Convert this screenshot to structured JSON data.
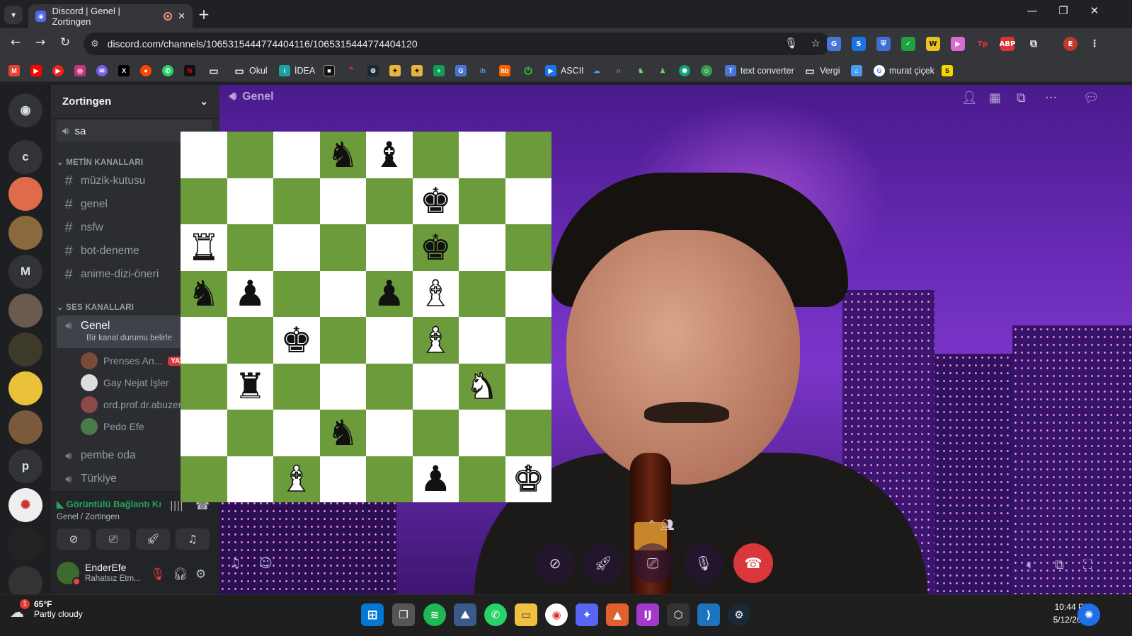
{
  "browser": {
    "tab_title": "Discord | Genel | Zortingen",
    "url": "discord.com/channels/1065315444774404116/1065315444774404120",
    "bookmarks": [
      "Okul",
      "İDEA",
      "ASCII",
      "text converter",
      "Vergi",
      "murat çiçek"
    ]
  },
  "rail": {
    "servers": [
      "c",
      "M",
      "p"
    ]
  },
  "sidebar": {
    "guild_name": "Zortingen",
    "top_voice": "sa",
    "text_category": "METİN KANALLARI",
    "text_channels": [
      "müzik-kutusu",
      "genel",
      "nsfw",
      "bot-deneme",
      "anime-dizi-öneri"
    ],
    "voice_category": "SES KANALLARI",
    "active_voice": {
      "name": "Genel",
      "status_placeholder": "Bir kanal durumu belirle"
    },
    "voice_users": [
      {
        "name": "Prenses An...",
        "badge": "YAY"
      },
      {
        "name": "Gay Nejat İşler"
      },
      {
        "name": "ord.prof.dr.abuzerk"
      },
      {
        "name": "Pedo Efe"
      }
    ],
    "other_voice": [
      "pembe oda",
      "Türkiye"
    ]
  },
  "voice_panel": {
    "status": "Görüntülü Bağlantı Kı",
    "location": "Genel / Zortingen"
  },
  "user_panel": {
    "username": "EnderEfe",
    "status": "Rahatsız Etm..."
  },
  "stage": {
    "channel_title": "Genel"
  },
  "chessboard": {
    "rows": [
      [
        "",
        "",
        "",
        "bN",
        "bB",
        "",
        "",
        ""
      ],
      [
        "",
        "",
        "",
        "",
        "",
        "bK",
        "",
        ""
      ],
      [
        "wR",
        "",
        "",
        "",
        "",
        "bK",
        "",
        ""
      ],
      [
        "bN",
        "bP",
        "",
        "",
        "bP",
        "wB",
        "",
        ""
      ],
      [
        "",
        "",
        "bK",
        "",
        "",
        "wB",
        "",
        ""
      ],
      [
        "",
        "bR",
        "",
        "",
        "",
        "",
        "wN",
        ""
      ],
      [
        "",
        "",
        "",
        "bN",
        "",
        "",
        "",
        ""
      ],
      [
        "",
        "",
        "wB",
        "",
        "",
        "bP",
        "",
        "wK"
      ]
    ]
  },
  "taskbar": {
    "temperature": "65°F",
    "weather_desc": "Partly cloudy",
    "weather_badge": "1",
    "time": "10:44 PM",
    "date": "5/12/2024"
  },
  "colors": {
    "board_dark": "#6b9b3a",
    "board_light": "#ffffff",
    "discord_green": "#23a55a",
    "end_call_red": "#da373c"
  }
}
